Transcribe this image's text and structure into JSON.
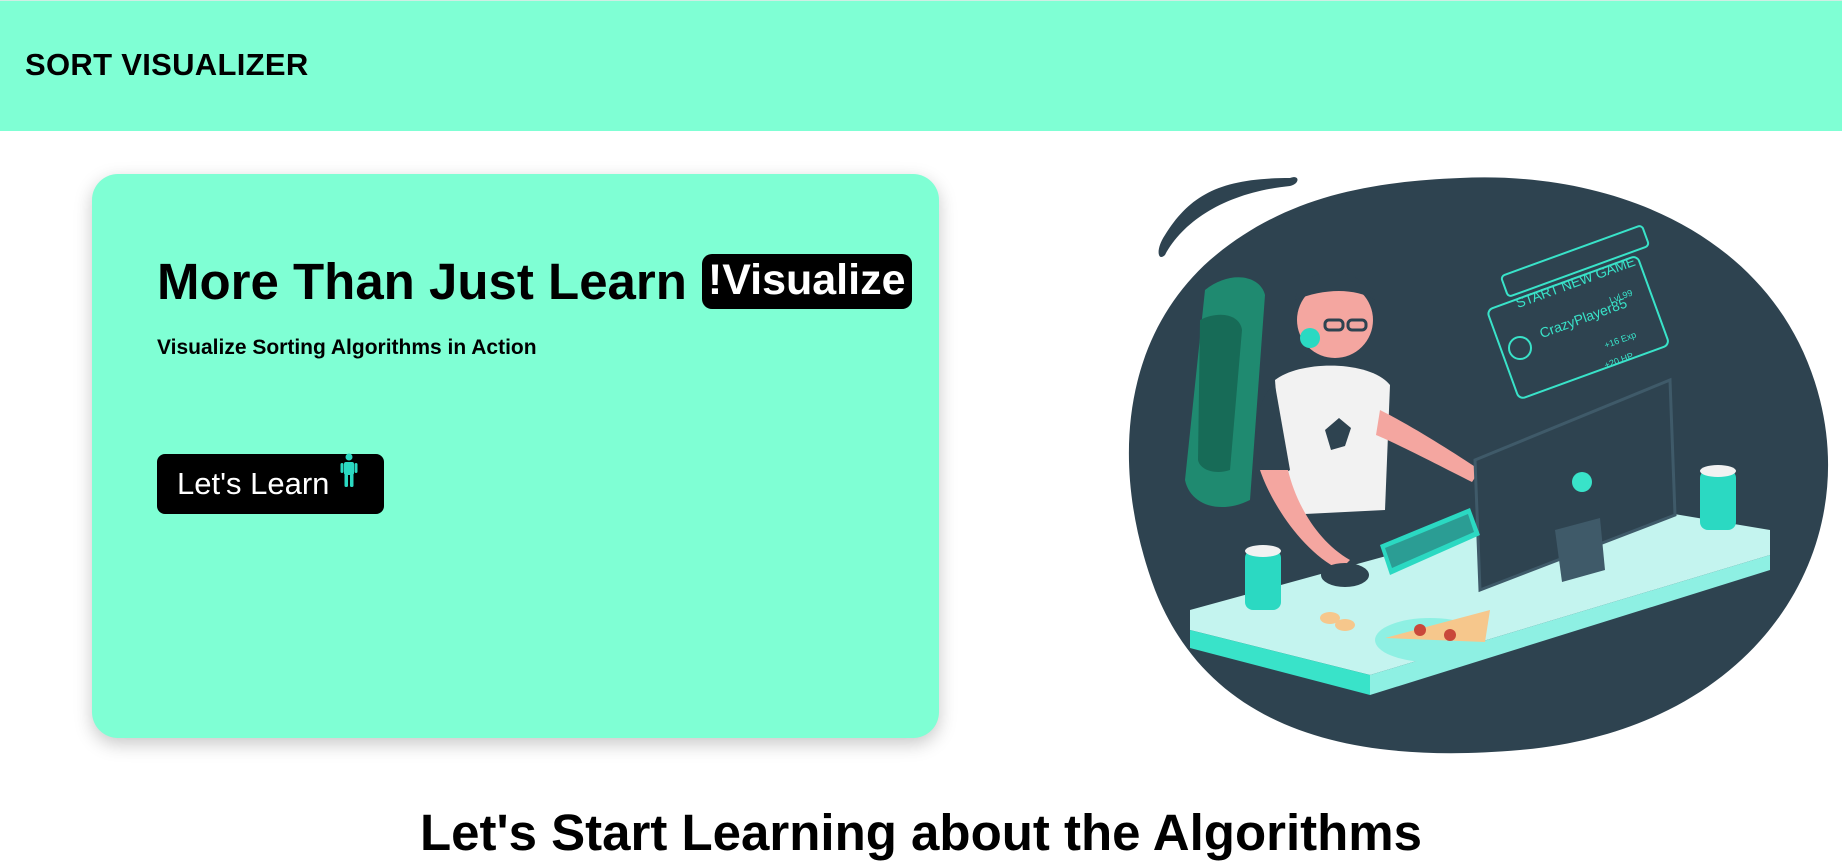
{
  "navbar": {
    "brand": "SORT VISUALIZER"
  },
  "hero": {
    "title": "More Than Just Learn",
    "highlight": "!Visualize",
    "subtitle": "Visualize Sorting Algorithms in Action",
    "cta_label": "Let's Learn",
    "cta_icon": "person-icon"
  },
  "illustration": {
    "icon": "gamer-at-desk-illustration",
    "screen_texts": {
      "start": "START NEW GAME",
      "player": "CrazyPlayer85",
      "level": "Lvl 99",
      "exp": "+16 Exp",
      "hp": "+20 HP"
    }
  },
  "section": {
    "heading": "Let's Start Learning about the Algorithms"
  },
  "colors": {
    "accent": "#7fffd4",
    "dark": "#000000",
    "illustration_dark": "#2e4350",
    "teal": "#2bd9c2"
  }
}
